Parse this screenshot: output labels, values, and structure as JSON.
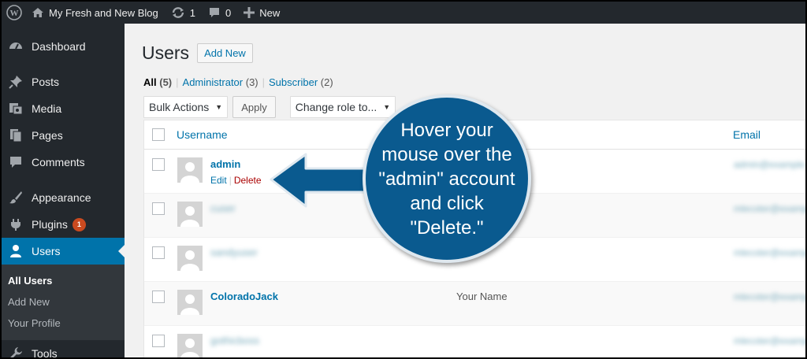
{
  "adminbar": {
    "site_name": "My Fresh and New Blog",
    "updates_count": "1",
    "comments_count": "0",
    "new_label": "New"
  },
  "sidebar": {
    "items": [
      {
        "label": "Dashboard",
        "icon": "dashboard-icon"
      },
      {
        "label": "Posts",
        "icon": "pin-icon"
      },
      {
        "label": "Media",
        "icon": "media-icon"
      },
      {
        "label": "Pages",
        "icon": "pages-icon"
      },
      {
        "label": "Comments",
        "icon": "comment-icon"
      },
      {
        "label": "Appearance",
        "icon": "brush-icon"
      },
      {
        "label": "Plugins",
        "icon": "plugin-icon",
        "badge": "1"
      },
      {
        "label": "Users",
        "icon": "user-icon"
      },
      {
        "label": "Tools",
        "icon": "wrench-icon"
      }
    ],
    "submenu": [
      "All Users",
      "Add New",
      "Your Profile"
    ]
  },
  "main": {
    "title": "Users",
    "add_new": "Add New",
    "filters": [
      {
        "label": "All",
        "count": "(5)"
      },
      {
        "label": "Administrator",
        "count": "(3)"
      },
      {
        "label": "Subscriber",
        "count": "(2)"
      }
    ],
    "bulk_actions": "Bulk Actions",
    "apply": "Apply",
    "change_role": "Change role to...",
    "table": {
      "col_username": "Username",
      "col_email": "Email",
      "rows": [
        {
          "username": "admin",
          "name": "",
          "edit": "Edit",
          "delete": "Delete"
        },
        {
          "username": "cuser",
          "name": ""
        },
        {
          "username": "sandyuser",
          "name": ""
        },
        {
          "username": "ColoradoJack",
          "name": "Your Name"
        },
        {
          "username": "gothicboss",
          "name": ""
        }
      ]
    }
  },
  "callout": {
    "text": "Hover your mouse over the \"admin\" account and click \"Delete.\""
  },
  "colors": {
    "adminbar_bg": "#23282d",
    "accent": "#0073aa",
    "callout_bg": "#0a5a8f",
    "delete_red": "#a00"
  }
}
